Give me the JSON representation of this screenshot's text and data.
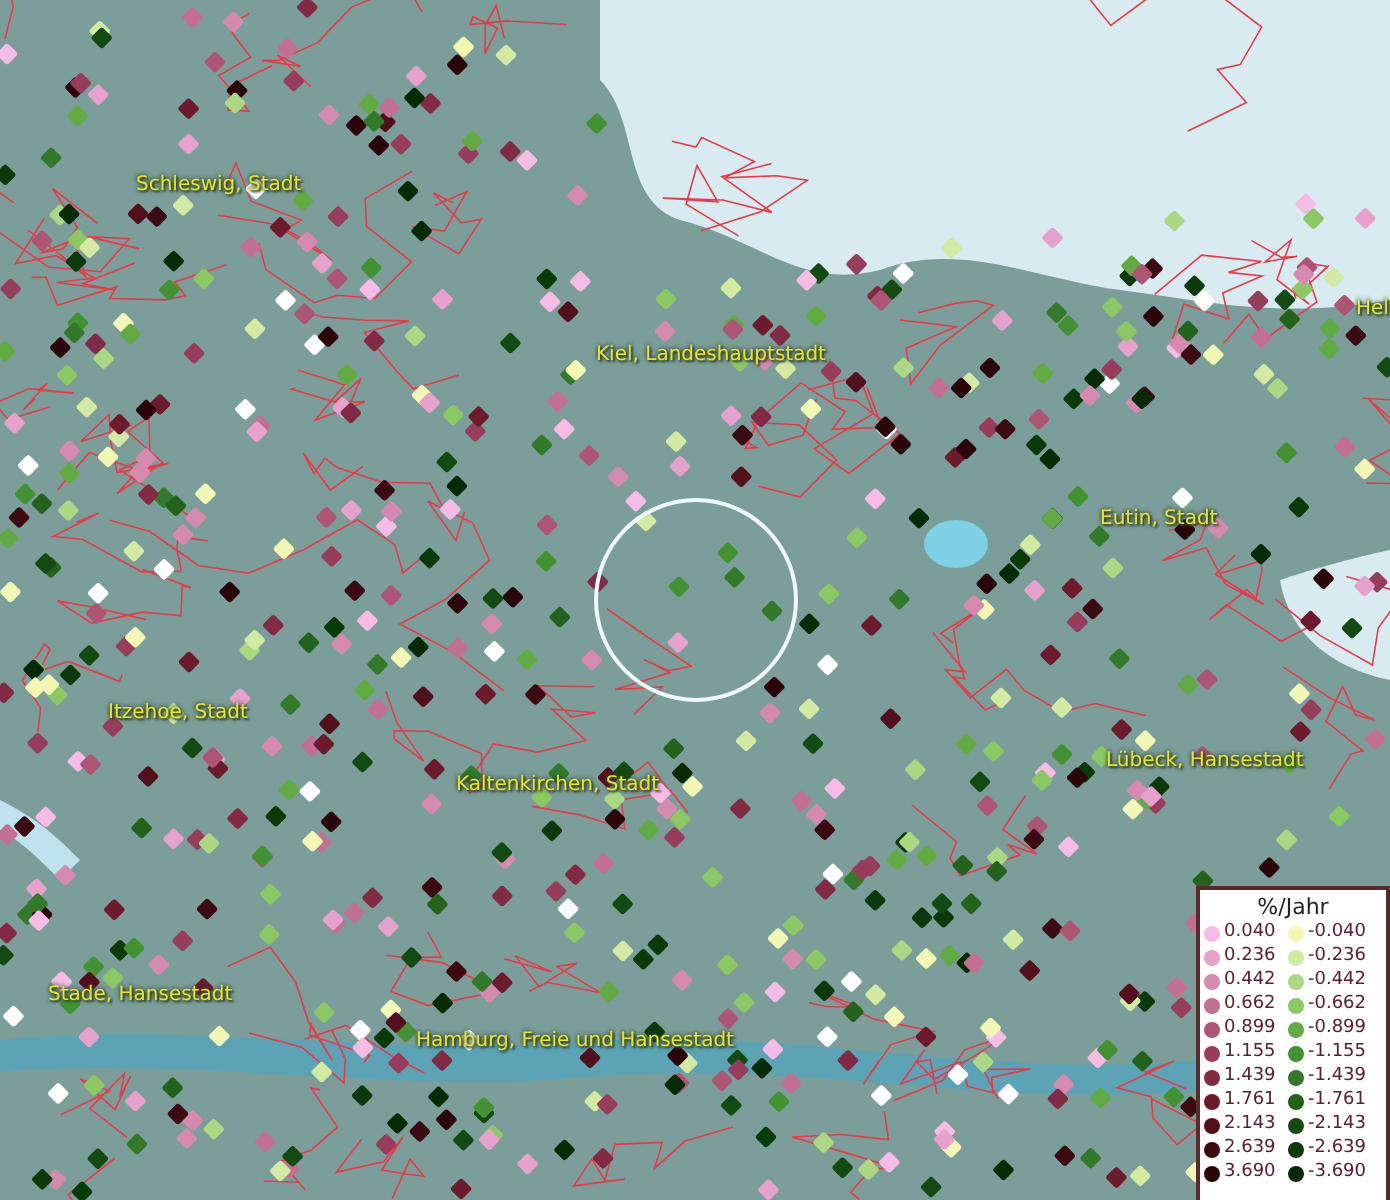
{
  "map": {
    "places": [
      {
        "name": "Schleswig, Stadt"
      },
      {
        "name": "Kiel, Landeshauptstadt"
      },
      {
        "name": "Hel"
      },
      {
        "name": "Eutin, Stadt"
      },
      {
        "name": "Itzehoe, Stadt"
      },
      {
        "name": "Lübeck, Hansestadt"
      },
      {
        "name": "Kaltenkirchen, Stadt"
      },
      {
        "name": "Stade, Hansestadt"
      },
      {
        "name": "Hamburg, Freie und Hansestadt"
      }
    ]
  },
  "legend": {
    "title": "%/Jahr",
    "items": [
      {
        "label": "0.040",
        "color": "#f6bce6"
      },
      {
        "label": "-0.040",
        "color": "#f2f8b4"
      },
      {
        "label": "0.236",
        "color": "#e6a2cc"
      },
      {
        "label": "-0.236",
        "color": "#d2eaa2"
      },
      {
        "label": "0.442",
        "color": "#d68ab0"
      },
      {
        "label": "-0.442",
        "color": "#acd884"
      },
      {
        "label": "0.662",
        "color": "#c47092"
      },
      {
        "label": "-0.662",
        "color": "#8cc864"
      },
      {
        "label": "0.899",
        "color": "#ae5474"
      },
      {
        "label": "-0.899",
        "color": "#62aa42"
      },
      {
        "label": "1.155",
        "color": "#983c5c"
      },
      {
        "label": "-1.155",
        "color": "#429232"
      },
      {
        "label": "1.439",
        "color": "#822a44"
      },
      {
        "label": "-1.439",
        "color": "#327a2a"
      },
      {
        "label": "1.761",
        "color": "#6c1a2c"
      },
      {
        "label": "-1.761",
        "color": "#22621a"
      },
      {
        "label": "2.143",
        "color": "#52101c"
      },
      {
        "label": "-2.143",
        "color": "#124a12"
      },
      {
        "label": "2.639",
        "color": "#3c0a12"
      },
      {
        "label": "-2.639",
        "color": "#0a3a0a"
      },
      {
        "label": "3.690",
        "color": "#2a060a"
      },
      {
        "label": "-3.690",
        "color": "#052a06"
      }
    ]
  }
}
